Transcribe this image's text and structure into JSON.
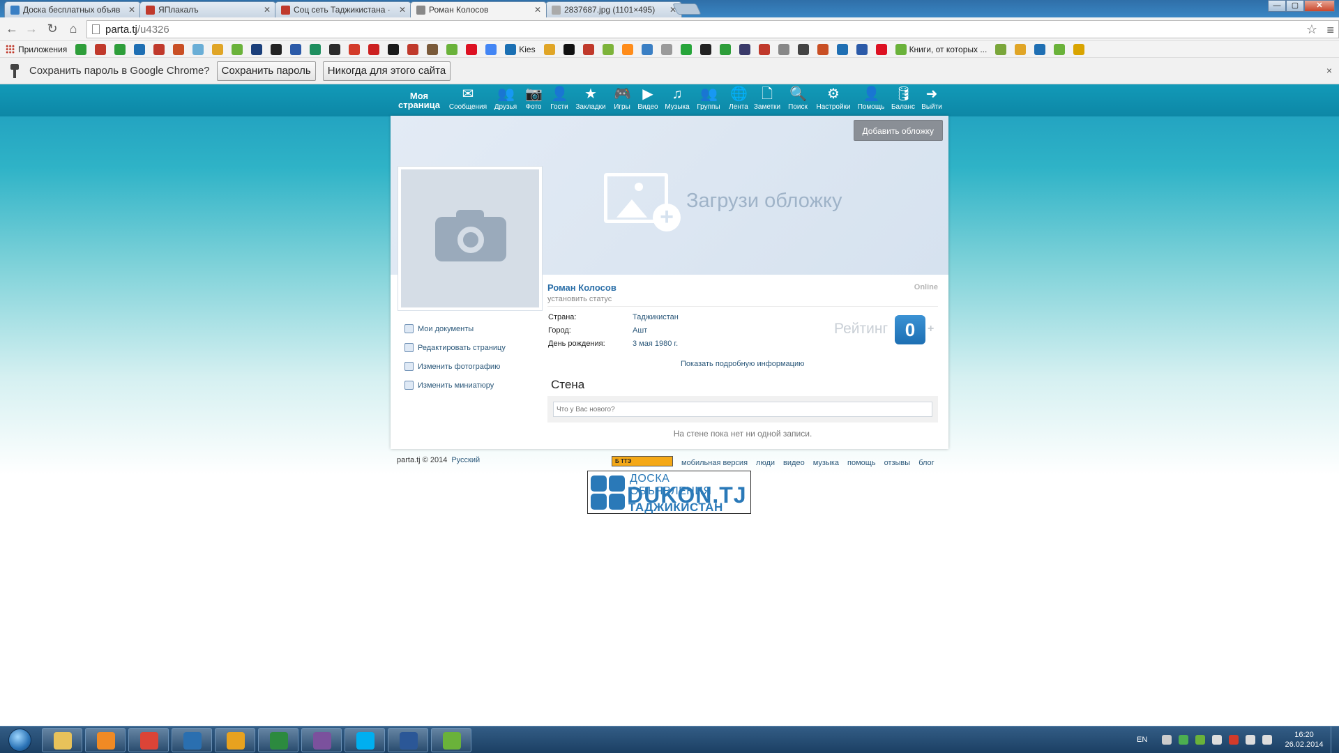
{
  "browser": {
    "tabs": [
      {
        "title": "Доска бесплатных объяв",
        "favicon_color": "#3a7fc4"
      },
      {
        "title": "ЯПлакалъ",
        "favicon_color": "#c0392b"
      },
      {
        "title": "Соц сеть Таджикистана ·",
        "favicon_color": "#c0392b"
      },
      {
        "title": "Роман Колосов",
        "favicon_color": "#888888"
      },
      {
        "title": "2837687.jpg (1101×495)",
        "favicon_color": "#aaaaaa"
      }
    ],
    "window_buttons": {
      "minimize": "—",
      "maximize": "▢",
      "close": "✕"
    },
    "nav": {
      "back": "←",
      "forward": "→",
      "reload": "↻",
      "home": "⌂"
    },
    "address": {
      "domain": "parta.tj",
      "path": "/u4326"
    },
    "bookmarks": {
      "apps_label": "Приложения",
      "kies_label": "Kies",
      "books_label": "Книги, от которых ...",
      "icon_colors": [
        "#2e9e3a",
        "#c0392b",
        "#2e9e3a",
        "#1f6fb3",
        "#c0392b",
        "#c94f24",
        "#6aaed6",
        "#e0a526",
        "#6ab23a",
        "#1b3f7a",
        "#222222",
        "#2b5aa8",
        "#1f8f5f",
        "#2b2b2b",
        "#d33b2a",
        "#cc2020",
        "#1a1a1a",
        "#c0392b",
        "#7a5a3a",
        "#6ab23a",
        "#d12",
        "#4285f4",
        "#1a6fb3",
        "#e0a526",
        "#111111",
        "#c0392b",
        "#7db33a",
        "#ff8c1a",
        "#3a7fc4",
        "#9a9a9a",
        "#27a53a",
        "#222222",
        "#2e9e3a",
        "#3a3a6a",
        "#c0392b",
        "#888888",
        "#444444",
        "#c94f24",
        "#1f6fb3",
        "#2b5aa8",
        "#d12",
        "#6ab23a",
        "#7aa63a",
        "#e0a526",
        "#1f6fb3",
        "#6ab23a",
        "#d9a400"
      ]
    },
    "infobar": {
      "question": "Сохранить пароль в Google Chrome?",
      "save_button": "Сохранить пароль",
      "never_button": "Никогда для этого сайта",
      "close": "×"
    }
  },
  "site": {
    "my_page": "Моя страница",
    "nav": [
      {
        "label": "Сообщения",
        "icon": "✉",
        "icon_name": "mail-icon"
      },
      {
        "label": "Друзья",
        "icon": "👥",
        "icon_name": "friends-icon"
      },
      {
        "label": "Фото",
        "icon": "📷",
        "icon_name": "camera-icon"
      },
      {
        "label": "Гости",
        "icon": "👤",
        "icon_name": "guests-icon"
      },
      {
        "label": "Закладки",
        "icon": "★",
        "icon_name": "star-icon"
      },
      {
        "label": "Игры",
        "icon": "🎮",
        "icon_name": "gamepad-icon"
      },
      {
        "label": "Видео",
        "icon": "▶",
        "icon_name": "play-icon"
      },
      {
        "label": "Музыка",
        "icon": "♫",
        "icon_name": "music-icon"
      },
      {
        "label": "Группы",
        "icon": "👥",
        "icon_name": "groups-icon"
      },
      {
        "label": "Лента",
        "icon": "🌐",
        "icon_name": "globe-icon"
      },
      {
        "label": "Заметки",
        "icon": "🗋",
        "icon_name": "note-icon"
      },
      {
        "label": "Поиск",
        "icon": "🔍",
        "icon_name": "search-icon"
      },
      {
        "label": "Настройки",
        "icon": "⚙",
        "icon_name": "gear-icon"
      },
      {
        "label": "Помощь",
        "icon": "👤",
        "icon_name": "help-icon"
      },
      {
        "label": "Баланс",
        "icon": "🛢",
        "icon_name": "balance-icon"
      },
      {
        "label": "Выйти",
        "icon": "➜",
        "icon_name": "logout-icon"
      }
    ],
    "add_cover": "Добавить обложку",
    "upload_cover": "Загрузи обложку",
    "profile": {
      "name": "Роман Колосов",
      "set_status": "установить статус",
      "online": "Online",
      "country_label": "Страна:",
      "country": "Таджикистан",
      "city_label": "Город:",
      "city": "Ашт",
      "birthday_label": "День рождения:",
      "birthday": "3 мая 1980 г.",
      "rating_label": "Рейтинг",
      "rating_value": "0",
      "rating_plus": "+",
      "more_info": "Показать подробную информацию"
    },
    "side_links": [
      "Мои документы",
      "Редактировать страницу",
      "Изменить фотографию",
      "Изменить миниатюру"
    ],
    "wall": {
      "title": "Стена",
      "placeholder": "Что у Вас нового?",
      "empty": "На стене пока нет ни одной записи."
    },
    "footer": {
      "copyright": "parta.tj © 2014",
      "language": "Русский",
      "counter": "Б ТТЭ",
      "links": [
        "мобильная версия",
        "люди",
        "видео",
        "музыка",
        "помощь",
        "отзывы",
        "блог"
      ]
    },
    "banner": {
      "line1": "ДОСКА ОБЪЯВЛЕНИЯ",
      "line2": "DUKON.TJ",
      "line3": "ТАДЖИКИСТАН"
    }
  },
  "taskbar": {
    "apps": [
      {
        "name": "explorer",
        "color": "#e8c25a"
      },
      {
        "name": "media-player",
        "color": "#f08a24"
      },
      {
        "name": "chrome",
        "color": "#db4437"
      },
      {
        "name": "r-app",
        "color": "#2a6fb0"
      },
      {
        "name": "outlook",
        "color": "#e8a21f"
      },
      {
        "name": "excel",
        "color": "#2c8a3f"
      },
      {
        "name": "viber",
        "color": "#7b519d"
      },
      {
        "name": "skype",
        "color": "#00aff0"
      },
      {
        "name": "word",
        "color": "#2b5797"
      },
      {
        "name": "network-tool",
        "color": "#6ab23a"
      }
    ],
    "lang": "EN",
    "tray_colors": [
      "#cccccc",
      "#4caf50",
      "#6ab23a",
      "#dddddd",
      "#d33b2a",
      "#dddddd",
      "#dddddd"
    ],
    "time": "16:20",
    "date": "26.02.2014"
  }
}
